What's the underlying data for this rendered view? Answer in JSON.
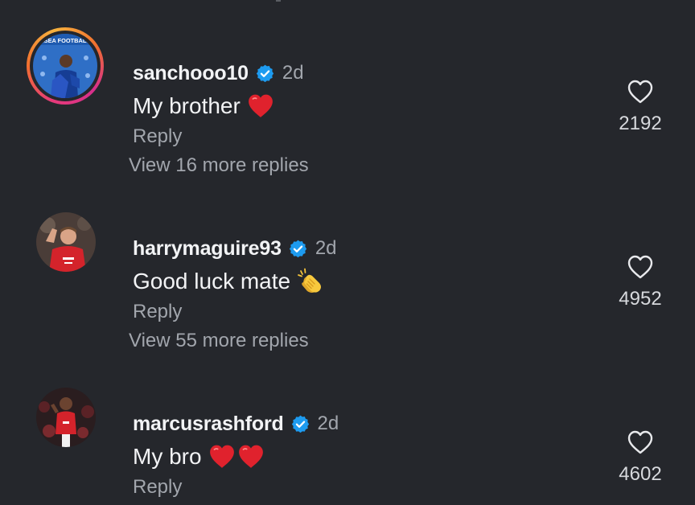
{
  "colors": {
    "background": "#25272c",
    "primary_text": "#f2f3f5",
    "secondary_text": "#a2a6ad",
    "verified_blue": "#1d9bf0",
    "heart_red": "#e0222d"
  },
  "comments": [
    {
      "username": "sanchooo10",
      "verified": true,
      "time": "2d",
      "text": "My brother",
      "emoji": [
        "red-heart"
      ],
      "reply_label": "Reply",
      "like_count": "2192",
      "avatar_icon": "profile-photo",
      "avatar_text": "LSEA FOOTBALL",
      "story_ring": true
    },
    {
      "username": "harrymaguire93",
      "verified": true,
      "time": "2d",
      "text": "Good luck mate",
      "emoji": [
        "clapping-hands"
      ],
      "reply_label": "Reply",
      "like_count": "4952",
      "avatar_icon": "profile-photo",
      "story_ring": false
    },
    {
      "username": "marcusrashford",
      "verified": true,
      "time": "2d",
      "text": "My bro",
      "emoji": [
        "red-heart",
        "red-heart"
      ],
      "reply_label": "Reply",
      "like_count": "4602",
      "avatar_icon": "profile-photo",
      "story_ring": false
    }
  ],
  "view_replies": [
    "View 16 more replies",
    "View 55 more replies"
  ]
}
